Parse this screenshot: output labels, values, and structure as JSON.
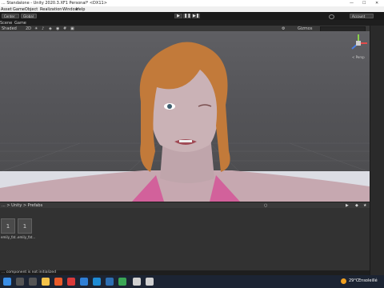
{
  "window": {
    "title": "... Standalone - Unity 2020.3.XF1 Personal* <DX11>",
    "min": "—",
    "max": "☐",
    "close": "✕"
  },
  "menu": {
    "items": [
      "Asset",
      "GameObject",
      "Realization",
      "Window",
      "Help"
    ]
  },
  "toolbar": {
    "center_label": "Center",
    "global_label": "Global",
    "account_label": "Account"
  },
  "tabs": {
    "scene": "Scene",
    "game": "Game"
  },
  "scene_toolbar": {
    "shading": "Shaded",
    "mode_2d": "2D",
    "gizmos": "Gizmos",
    "persp_label": "< Persp"
  },
  "project": {
    "breadcrumb": "... > Unity > Prefabs",
    "assets": [
      {
        "name": "emily_fat..."
      },
      {
        "name": "emily_fat..."
      }
    ]
  },
  "status": {
    "message": "... component is not initialized"
  },
  "taskbar": {
    "weather_temp": "29°C",
    "weather_desc": "Ensoleillé"
  },
  "colors": {
    "viewport_bg": "#555559",
    "ground": "#dcdde4",
    "hair": "#c27a3a",
    "skin": "#cab2b6",
    "taskbar": "#1c2433"
  }
}
